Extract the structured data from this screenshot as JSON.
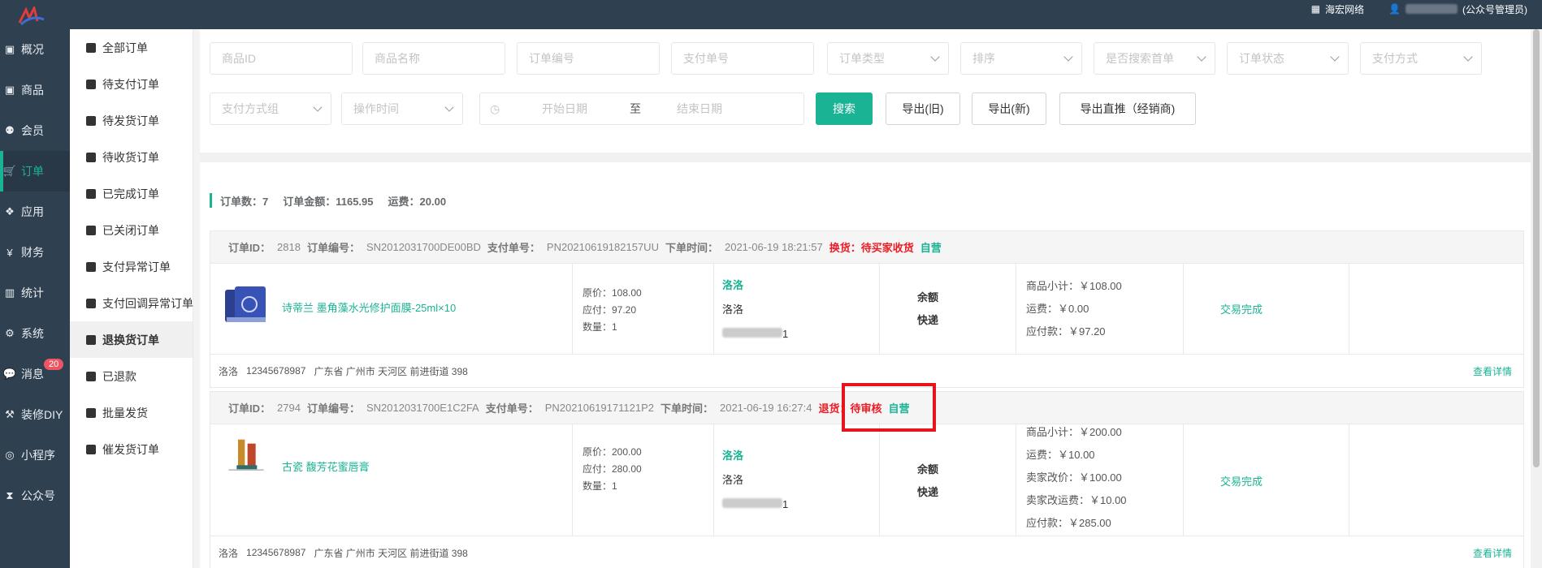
{
  "topbar": {
    "company": "海宏网络",
    "user_suffix": "(公众号管理员)"
  },
  "sidenav": {
    "items": [
      {
        "label": "概况",
        "icon": "dashboard-icon"
      },
      {
        "label": "商品",
        "icon": "box-icon"
      },
      {
        "label": "会员",
        "icon": "users-icon"
      },
      {
        "label": "订单",
        "icon": "cart-icon",
        "active": true
      },
      {
        "label": "应用",
        "icon": "cubes-icon"
      },
      {
        "label": "财务",
        "icon": "yen-icon"
      },
      {
        "label": "统计",
        "icon": "bar-chart-icon"
      },
      {
        "label": "系统",
        "icon": "gears-icon"
      },
      {
        "label": "消息",
        "icon": "comment-icon",
        "badge": "20"
      },
      {
        "label": "装修DIY",
        "icon": "gavel-icon"
      },
      {
        "label": "小程序",
        "icon": "wechat-icon"
      },
      {
        "label": "公众号",
        "icon": "hourglass-icon"
      }
    ]
  },
  "subnav": {
    "items": [
      "全部订单",
      "待支付订单",
      "待发货订单",
      "待收货订单",
      "已完成订单",
      "已关闭订单",
      "支付异常订单",
      "支付回调异常订单",
      "退换货订单",
      "已退款",
      "批量发货",
      "催发货订单"
    ],
    "active": "退换货订单"
  },
  "filters": {
    "product_id": "商品ID",
    "product_name": "商品名称",
    "order_no": "订单编号",
    "pay_no": "支付单号",
    "order_type": "订单类型",
    "sort": "排序",
    "first_search": "是否搜索首单",
    "order_status": "订单状态",
    "pay_method": "支付方式",
    "pay_method_group": "支付方式组",
    "op_time": "操作时间",
    "start_date": "开始日期",
    "date_sep": "至",
    "end_date": "结束日期",
    "search_btn": "搜索",
    "export_old": "导出(旧)",
    "export_new": "导出(新)",
    "export_direct": "导出直推（经销商)"
  },
  "summary": {
    "count": "订单数：7",
    "amount": "订单金额：1165.95",
    "freight": "运费：20.00"
  },
  "orders": [
    {
      "id_label": "订单ID：",
      "id": "2818",
      "no_label": "订单编号：",
      "no": "SN2012031700DE00BD",
      "pay_label": "支付单号：",
      "pay_no": "PN20210619182157UU",
      "time_label": "下单时间：",
      "time": "2021-06-19 18:21:57",
      "status": "换货：待买家收货",
      "self": "自营",
      "product": "诗蒂兰 墨角藻水光修护面膜-25ml×10",
      "prices": [
        "原价：108.00",
        "应付：97.20",
        "数量：1"
      ],
      "buyer": "洛洛",
      "buyer2": "洛洛",
      "phone_tail": "1",
      "pay_type": "余额",
      "ship_type": "快递",
      "sums": [
        "商品小计：￥108.00",
        "运费：￥0.00",
        "应付款：￥97.20"
      ],
      "trade_status": "交易完成",
      "address": [
        "洛洛",
        "12345678987",
        "广东省 广州市 天河区 前进街道 398"
      ],
      "detail": "查看详情"
    },
    {
      "id_label": "订单ID：",
      "id": "2794",
      "no_label": "订单编号：",
      "no": "SN2012031700E1C2FA",
      "pay_label": "支付单号：",
      "pay_no": "PN20210619171121P2",
      "time_label": "下单时间：",
      "time": "2021-06-19 16:27:4",
      "status": "退货：待审核",
      "self": "自营",
      "product": "古瓷 馥芳花蜜唇膏",
      "prices": [
        "原价：200.00",
        "应付：280.00",
        "数量：1"
      ],
      "buyer": "洛洛",
      "buyer2": "洛洛",
      "phone_tail": "1",
      "pay_type": "余额",
      "ship_type": "快递",
      "sums": [
        "商品小计：￥200.00",
        "运费：￥10.00",
        "卖家改价：￥100.00",
        "卖家改运费：￥10.00",
        "应付款：￥285.00"
      ],
      "trade_status": "交易完成",
      "address": [
        "洛洛",
        "12345678987",
        "广东省 广州市 天河区 前进街道 398"
      ],
      "detail": "查看详情"
    }
  ]
}
